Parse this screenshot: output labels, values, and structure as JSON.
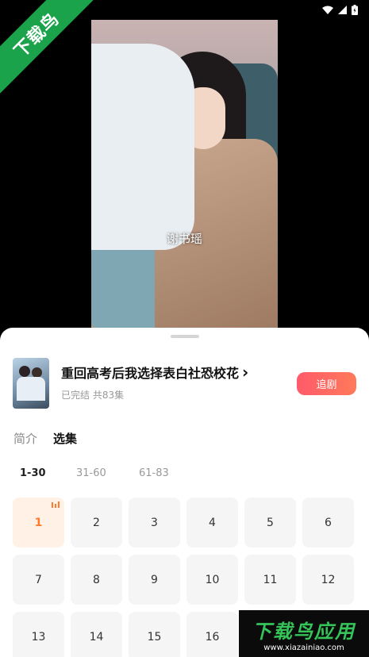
{
  "status_bar": {
    "icons": [
      "wifi-icon",
      "signal-icon",
      "battery-icon"
    ]
  },
  "badge": {
    "text": "下载鸟",
    "color": "#1aa34a"
  },
  "video": {
    "caption": "谢书瑶"
  },
  "drama": {
    "title": "重回高考后我选择表白社恐校花",
    "chevron": "›",
    "meta": "已完结 共83集",
    "follow_label": "追剧"
  },
  "tabs": [
    {
      "label": "简介",
      "active": false
    },
    {
      "label": "选集",
      "active": true
    }
  ],
  "ranges": [
    {
      "label": "1-30",
      "active": true
    },
    {
      "label": "31-60",
      "active": false
    },
    {
      "label": "61-83",
      "active": false
    }
  ],
  "episodes": [
    "1",
    "2",
    "3",
    "4",
    "5",
    "6",
    "7",
    "8",
    "9",
    "10",
    "11",
    "12",
    "13",
    "14",
    "15",
    "16"
  ],
  "current_episode": "1",
  "watermark": {
    "main": "下载鸟应用",
    "url": "www.xiazainiao.com"
  },
  "colors": {
    "accent": "#ff5a6a",
    "active_episode_bg": "#fff1e6",
    "active_episode_text": "#ff7a2e"
  }
}
